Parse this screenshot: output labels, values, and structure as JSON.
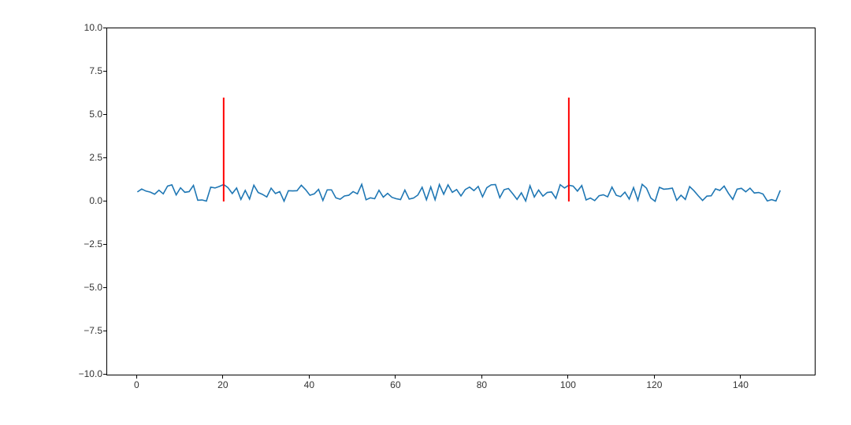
{
  "chart_data": {
    "type": "line",
    "x": [
      0,
      1,
      2,
      3,
      4,
      5,
      6,
      7,
      8,
      9,
      10,
      11,
      12,
      13,
      14,
      15,
      16,
      17,
      18,
      19,
      20,
      21,
      22,
      23,
      24,
      25,
      26,
      27,
      28,
      29,
      30,
      31,
      32,
      33,
      34,
      35,
      36,
      37,
      38,
      39,
      40,
      41,
      42,
      43,
      44,
      45,
      46,
      47,
      48,
      49,
      50,
      51,
      52,
      53,
      54,
      55,
      56,
      57,
      58,
      59,
      60,
      61,
      62,
      63,
      64,
      65,
      66,
      67,
      68,
      69,
      70,
      71,
      72,
      73,
      74,
      75,
      76,
      77,
      78,
      79,
      80,
      81,
      82,
      83,
      84,
      85,
      86,
      87,
      88,
      89,
      90,
      91,
      92,
      93,
      94,
      95,
      96,
      97,
      98,
      99,
      100,
      101,
      102,
      103,
      104,
      105,
      106,
      107,
      108,
      109,
      110,
      111,
      112,
      113,
      114,
      115,
      116,
      117,
      118,
      119,
      120,
      121,
      122,
      123,
      124,
      125,
      126,
      127,
      128,
      129,
      130,
      131,
      132,
      133,
      134,
      135,
      136,
      137,
      138,
      139,
      140,
      141,
      142,
      143,
      144,
      145,
      146,
      147,
      148,
      149
    ],
    "y": [
      0.55,
      0.72,
      0.6,
      0.54,
      0.42,
      0.65,
      0.44,
      0.89,
      0.96,
      0.38,
      0.79,
      0.53,
      0.57,
      0.93,
      0.07,
      0.09,
      0.02,
      0.83,
      0.78,
      0.87,
      0.98,
      0.8,
      0.46,
      0.78,
      0.12,
      0.64,
      0.14,
      0.94,
      0.52,
      0.41,
      0.26,
      0.77,
      0.46,
      0.57,
      0.02,
      0.62,
      0.61,
      0.62,
      0.94,
      0.68,
      0.36,
      0.44,
      0.7,
      0.06,
      0.67,
      0.67,
      0.21,
      0.13,
      0.32,
      0.36,
      0.57,
      0.44,
      0.99,
      0.1,
      0.21,
      0.16,
      0.65,
      0.25,
      0.47,
      0.24,
      0.16,
      0.11,
      0.66,
      0.14,
      0.2,
      0.37,
      0.82,
      0.1,
      0.84,
      0.1,
      0.98,
      0.42,
      0.96,
      0.53,
      0.69,
      0.32,
      0.69,
      0.83,
      0.63,
      0.87,
      0.27,
      0.8,
      0.96,
      0.98,
      0.22,
      0.68,
      0.75,
      0.45,
      0.12,
      0.5,
      0.03,
      0.91,
      0.26,
      0.66,
      0.31,
      0.52,
      0.55,
      0.18,
      0.97,
      0.78,
      0.94,
      0.89,
      0.6,
      0.92,
      0.09,
      0.2,
      0.05,
      0.33,
      0.39,
      0.27,
      0.83,
      0.36,
      0.28,
      0.54,
      0.14,
      0.8,
      0.07,
      0.99,
      0.77,
      0.2,
      0.01,
      0.82,
      0.71,
      0.73,
      0.77,
      0.07,
      0.36,
      0.12,
      0.86,
      0.62,
      0.33,
      0.06,
      0.31,
      0.33,
      0.73,
      0.64,
      0.89,
      0.47,
      0.12,
      0.71,
      0.76,
      0.56,
      0.77,
      0.49,
      0.52,
      0.43,
      0.03,
      0.11,
      0.03,
      0.64
    ],
    "vlines": [
      {
        "x": 20,
        "ymin": 0,
        "ymax": 6,
        "color": "red"
      },
      {
        "x": 100,
        "ymin": 0,
        "ymax": 6,
        "color": "red"
      }
    ],
    "xlim": [
      -7,
      157
    ],
    "ylim": [
      -10,
      10
    ],
    "xticks": [
      0,
      20,
      40,
      60,
      80,
      100,
      120,
      140
    ],
    "yticks": [
      -10.0,
      -7.5,
      -5.0,
      -2.5,
      0.0,
      2.5,
      5.0,
      7.5,
      10.0
    ],
    "xtick_labels": [
      "0",
      "20",
      "40",
      "60",
      "80",
      "100",
      "120",
      "140"
    ],
    "ytick_labels": [
      "−10.0",
      "−7.5",
      "−5.0",
      "−2.5",
      "0.0",
      "2.5",
      "5.0",
      "7.5",
      "10.0"
    ],
    "line_color": "#1f77b4",
    "title": "",
    "xlabel": "",
    "ylabel": ""
  }
}
